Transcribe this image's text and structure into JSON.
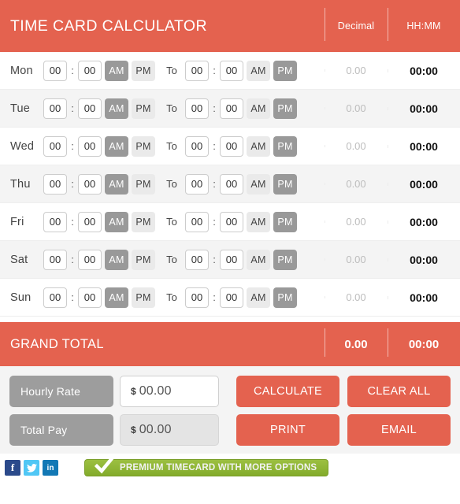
{
  "header": {
    "title": "TIME CARD CALCULATOR",
    "col_decimal": "Decimal",
    "col_hhmm": "HH:MM"
  },
  "row_defaults": {
    "hour": "00",
    "minute": "00",
    "colon": ":",
    "to": "To",
    "am": "AM",
    "pm": "PM",
    "decimal": "0.00",
    "hhmm": "00:00"
  },
  "rows": [
    {
      "day": "Mon",
      "in_hour": "00",
      "in_min": "00",
      "in_meridiem": "AM",
      "out_hour": "00",
      "out_min": "00",
      "out_meridiem": "PM",
      "decimal": "0.00",
      "hhmm": "00:00",
      "shaded": false
    },
    {
      "day": "Tue",
      "in_hour": "00",
      "in_min": "00",
      "in_meridiem": "AM",
      "out_hour": "00",
      "out_min": "00",
      "out_meridiem": "PM",
      "decimal": "0.00",
      "hhmm": "00:00",
      "shaded": true
    },
    {
      "day": "Wed",
      "in_hour": "00",
      "in_min": "00",
      "in_meridiem": "AM",
      "out_hour": "00",
      "out_min": "00",
      "out_meridiem": "PM",
      "decimal": "0.00",
      "hhmm": "00:00",
      "shaded": false
    },
    {
      "day": "Thu",
      "in_hour": "00",
      "in_min": "00",
      "in_meridiem": "AM",
      "out_hour": "00",
      "out_min": "00",
      "out_meridiem": "PM",
      "decimal": "0.00",
      "hhmm": "00:00",
      "shaded": true
    },
    {
      "day": "Fri",
      "in_hour": "00",
      "in_min": "00",
      "in_meridiem": "AM",
      "out_hour": "00",
      "out_min": "00",
      "out_meridiem": "PM",
      "decimal": "0.00",
      "hhmm": "00:00",
      "shaded": false
    },
    {
      "day": "Sat",
      "in_hour": "00",
      "in_min": "00",
      "in_meridiem": "AM",
      "out_hour": "00",
      "out_min": "00",
      "out_meridiem": "PM",
      "decimal": "0.00",
      "hhmm": "00:00",
      "shaded": true
    },
    {
      "day": "Sun",
      "in_hour": "00",
      "in_min": "00",
      "in_meridiem": "AM",
      "out_hour": "00",
      "out_min": "00",
      "out_meridiem": "PM",
      "decimal": "0.00",
      "hhmm": "00:00",
      "shaded": false
    }
  ],
  "grand_total": {
    "label": "GRAND TOTAL",
    "decimal": "0.00",
    "hhmm": "00:00"
  },
  "controls": {
    "hourly_rate_label": "Hourly Rate",
    "hourly_rate_currency": "$",
    "hourly_rate_value": "00.00",
    "total_pay_label": "Total Pay",
    "total_pay_currency": "$",
    "total_pay_value": "00.00",
    "calculate_label": "CALCULATE",
    "clear_all_label": "CLEAR ALL",
    "print_label": "PRINT",
    "email_label": "EMAIL"
  },
  "footer": {
    "facebook_glyph": "f",
    "twitter_glyph": "",
    "linkedin_glyph": "in",
    "premium_label": "PREMIUM TIMECARD WITH MORE OPTIONS"
  },
  "colors": {
    "brand_red": "#e4624f",
    "selected_gray": "#999999",
    "unselected_gray": "#eaeaea",
    "tag_gray": "#9d9d9d",
    "premium_green": "#8db533",
    "row_alt": "#f4f4f4"
  }
}
